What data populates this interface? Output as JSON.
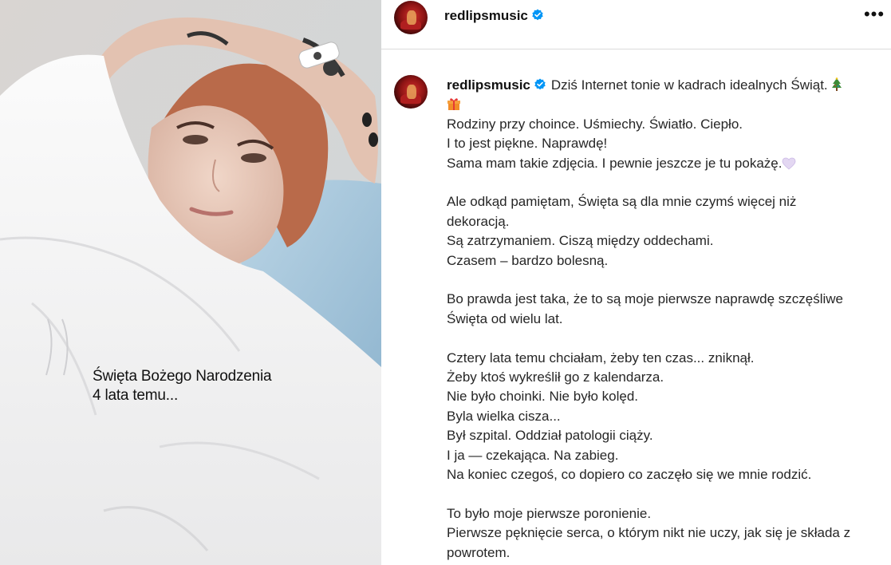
{
  "post": {
    "username": "redlipsmusic",
    "more_label": "•••",
    "photo_caption": [
      "Święta Bożego Narodzenia",
      "4 lata temu..."
    ],
    "caption_first_line": "Dziś Internet tonie w kadrach idealnych Świąt.",
    "caption_lines": [
      "Rodziny przy choince. Uśmiechy. Światło. Ciepło.",
      "I to jest piękne. Naprawdę!",
      "Sama mam takie zdjęcia. I pewnie jeszcze je tu pokażę.",
      "",
      "Ale odkąd pamiętam, Święta są dla mnie czymś więcej niż",
      "dekoracją.",
      "Są zatrzymaniem. Ciszą między oddechami.",
      "Czasem – bardzo bolesną.",
      "",
      "Bo prawda jest taka, że to są moje pierwsze naprawdę szczęśliwe",
      "Święta od wielu lat.",
      "",
      "Cztery lata temu chciałam, żeby ten czas... zniknął.",
      "Żeby ktoś wykreślił go z kalendarza.",
      "Nie było choinki. Nie było kolęd.",
      "Byla wielka cisza...",
      "Był szpital. Oddział patologii ciąży.",
      "I ja — czekająca. Na zabieg.",
      "Na koniec czegoś, co dopiero co zaczęło się we mnie rodzić.",
      "",
      "To było moje pierwsze poronienie.",
      "Pierwsze pęknięcie serca, o którym nikt nie uczy, jak się je składa z",
      "powrotem."
    ],
    "icons": {
      "verified": "verified-badge-icon",
      "tree": "christmas-tree-icon",
      "gift": "gift-icon",
      "heart": "light-purple-heart-icon"
    },
    "colors": {
      "verified_blue": "#0095f6",
      "text": "#262626",
      "border": "#dbdbdb"
    }
  }
}
